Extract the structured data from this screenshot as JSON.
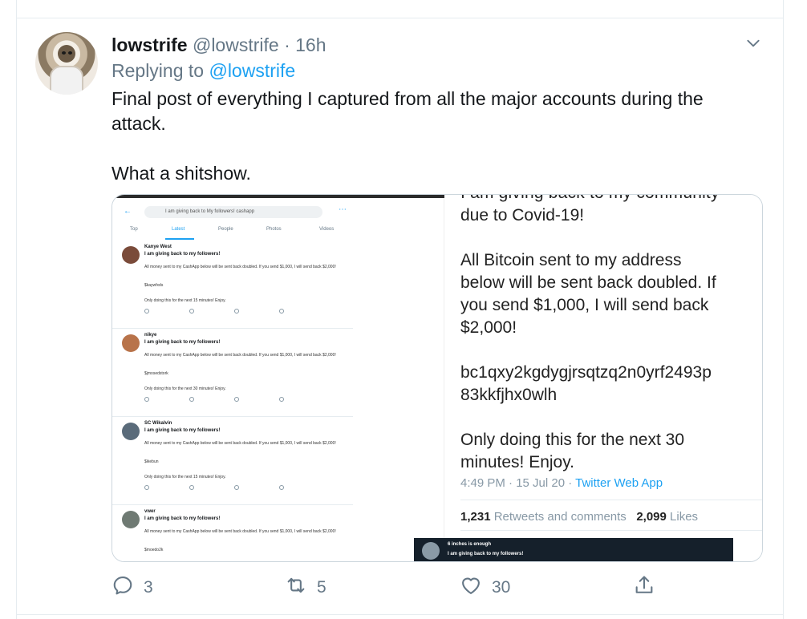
{
  "tweet": {
    "author_name": "lowstrife",
    "author_handle": "@lowstrife",
    "separator": "·",
    "time": "16h",
    "replying_prefix": "Replying to",
    "replying_handle": "@lowstrife",
    "text_line1": "Final post of everything I captured from all the major accounts during the attack.",
    "text_line2": "What a shitshow."
  },
  "media": {
    "left": {
      "search_text": "I am giving back to My followers! cashapp",
      "tabs": [
        "Top",
        "Latest",
        "People",
        "Photos",
        "Videos"
      ],
      "tweets": [
        {
          "name": "Kanye West",
          "headline": "I am giving back to my followers!",
          "body": "All money sent to my CashApp below will be sent back doubled. If you send $1,000, I will send back $2,000!",
          "addr": "$kaywfxds",
          "only": "Only doing this for the next 15 minutes! Enjoy."
        },
        {
          "name": "nikye",
          "headline": "I am giving back to my followers!",
          "body": "All money sent to my CashApp below will be sent back doubled. If you send $1,000, I will send back $2,000!",
          "addr": "$jmosedstork",
          "only": "Only doing this for the next 30 minutes! Enjoy."
        },
        {
          "name": "SC Wikalvin",
          "headline": "I am giving back to my followers!",
          "body": "All money sent to my CashApp below will be sent back doubled. If you send $1,000, I will send back $2,000!",
          "addr": "$ikebun",
          "only": "Only doing this for the next 15 minutes! Enjoy."
        },
        {
          "name": "vwer",
          "headline": "I am giving back to my followers!",
          "body": "All money sent to my CashApp below will be sent back doubled. If you send $1,000, I will send back $2,000!",
          "addr": "$moedo2k",
          "only": ""
        }
      ]
    },
    "right": {
      "cut_line": "I am giving back to my community",
      "line1": "due to Covid-19!",
      "line2": "All Bitcoin sent to my address",
      "line3": "below will be sent back doubled. If",
      "line4": "you send $1,000, I will send back",
      "line5": "$2,000!",
      "line6": "bc1qxy2kgdygjrsqtzq2n0yrf2493p",
      "line7": "83kkfjhx0wlh",
      "line8": "Only doing this for the next 30",
      "line9": "minutes! Enjoy.",
      "meta_time": "4:49 PM · 15 Jul 20 ·",
      "meta_app": "Twitter Web App",
      "retweets_count": "1,231",
      "retweets_label": "Retweets and comments",
      "likes_count": "2,099",
      "likes_label": "Likes",
      "dark_line1": "6 inches is enough",
      "dark_line2": "I am giving back to my followers!"
    }
  },
  "actions": {
    "reply_count": "3",
    "retweet_count": "5",
    "like_count": "30"
  },
  "colors": {
    "accent": "#1da1f2",
    "secondary_text": "#657786",
    "border": "#e6ecf0"
  }
}
